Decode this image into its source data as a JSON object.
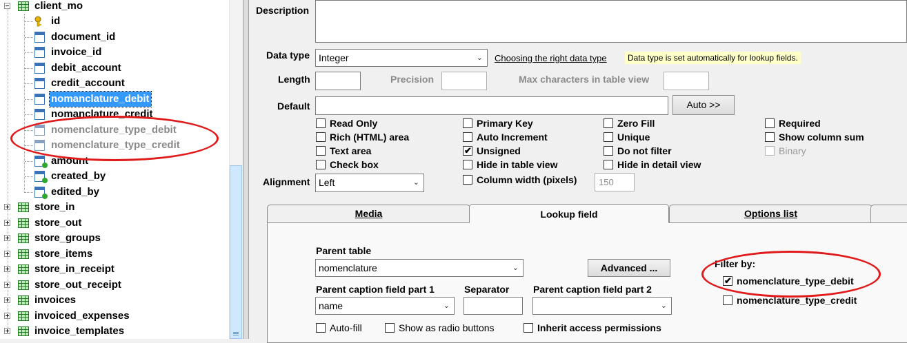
{
  "tree": {
    "root": "client_mo",
    "fields": [
      {
        "name": "id",
        "icon": "key-icon"
      },
      {
        "name": "document_id",
        "icon": "field-icon"
      },
      {
        "name": "invoice_id",
        "icon": "field-icon"
      },
      {
        "name": "debit_account",
        "icon": "field-icon"
      },
      {
        "name": "credit_account",
        "icon": "field-icon"
      },
      {
        "name": "nomanclature_debit",
        "icon": "field-icon",
        "selected": true
      },
      {
        "name": "nomanclature_credit",
        "icon": "field-icon"
      },
      {
        "name": "nomenclature_type_debit",
        "icon": "field-icon",
        "dim": true
      },
      {
        "name": "nomenclature_type_credit",
        "icon": "field-icon",
        "dim": true
      },
      {
        "name": "amount",
        "icon": "lookup-field-icon"
      },
      {
        "name": "created_by",
        "icon": "lookup-field-icon"
      },
      {
        "name": "edited_by",
        "icon": "lookup-field-icon"
      }
    ],
    "tables": [
      "store_in",
      "store_out",
      "store_groups",
      "store_items",
      "store_in_receipt",
      "store_out_receipt",
      "invoices",
      "invoiced_expenses",
      "invoice_templates"
    ]
  },
  "form": {
    "description_label": "Description",
    "data_type_label": "Data type",
    "data_type_value": "Integer",
    "data_type_link": "Choosing the right data type",
    "data_type_note": "Data type is set automatically for lookup fields.",
    "length_label": "Length",
    "precision_label": "Precision",
    "max_chars_label": "Max characters in table view",
    "default_label": "Default",
    "auto_button": "Auto >>",
    "alignment_label": "Alignment",
    "alignment_value": "Left",
    "column_width_label": "Column width (pixels)",
    "column_width_value": "150",
    "checkboxes": {
      "read_only": {
        "label": "Read Only",
        "checked": false
      },
      "rich_html": {
        "label": "Rich (HTML) area",
        "checked": false
      },
      "text_area": {
        "label": "Text area",
        "checked": false
      },
      "check_box": {
        "label": "Check box",
        "checked": false
      },
      "primary_key": {
        "label": "Primary Key",
        "checked": false
      },
      "auto_increment": {
        "label": "Auto Increment",
        "checked": false
      },
      "unsigned": {
        "label": "Unsigned",
        "checked": true
      },
      "hide_table": {
        "label": "Hide in table view",
        "checked": false
      },
      "zero_fill": {
        "label": "Zero Fill",
        "checked": false
      },
      "unique": {
        "label": "Unique",
        "checked": false
      },
      "do_not_filter": {
        "label": "Do not filter",
        "checked": false
      },
      "hide_detail": {
        "label": "Hide in detail view",
        "checked": false
      },
      "required": {
        "label": "Required",
        "checked": false
      },
      "show_sum": {
        "label": "Show column sum",
        "checked": false
      },
      "binary": {
        "label": "Binary",
        "checked": false,
        "disabled": true
      },
      "column_width": {
        "label": "Column width (pixels)",
        "checked": false
      }
    }
  },
  "tabs": [
    {
      "label": "Media",
      "active": false
    },
    {
      "label": "Lookup field",
      "active": true
    },
    {
      "label": "Options list",
      "active": false
    }
  ],
  "lookup": {
    "parent_table_label": "Parent table",
    "parent_table_value": "nomenclature",
    "advanced_button": "Advanced ...",
    "caption1_label": "Parent caption field part 1",
    "caption1_value": "name",
    "separator_label": "Separator",
    "caption2_label": "Parent caption field part 2",
    "caption2_value": "",
    "filter_label": "Filter by:",
    "filter_options": [
      {
        "label": "nomenclature_type_debit",
        "checked": true
      },
      {
        "label": "nomenclature_type_credit",
        "checked": false
      }
    ],
    "auto_fill": "Auto-fill",
    "radio_buttons": "Show as radio buttons",
    "inherit_permissions": "Inherit access permissions"
  },
  "colors": {
    "selection": "#3399ff",
    "annotation": "#e01b1b",
    "note_bg": "#ffffc8"
  }
}
